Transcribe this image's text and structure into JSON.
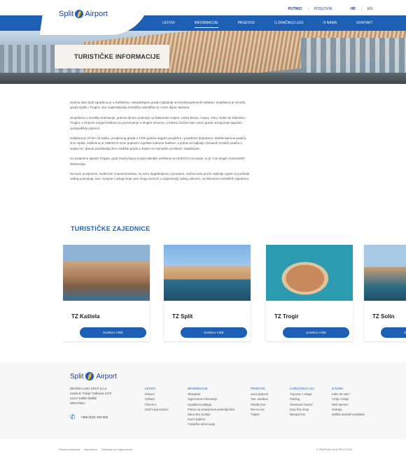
{
  "utility": {
    "putnici": "PUTNICI",
    "poslovni": "POSLOVNI",
    "hr": "HR",
    "en": "EN"
  },
  "brand": {
    "name": "Split",
    "suffix": "Airport"
  },
  "nav": {
    "items": [
      {
        "label": "LETOVI"
      },
      {
        "label": "INFORMACIJE",
        "active": true
      },
      {
        "label": "PRIJEVOZ"
      },
      {
        "label": "U ZRAČNOJ LUCI"
      },
      {
        "label": "O NAMA"
      },
      {
        "label": "KONTAKT"
      }
    ]
  },
  "page": {
    "title": "TURISTIČKE INFORMACIJE"
  },
  "intro": [
    "Zračna luka Split zgrađena je u Kaštelima, nekadašnjem gradu najstarije od srednjovjekovnih kaštela i smještena je između grada Splita i Trogira, dva najatraktivnija turistička odredišta na ovom dijelu Jadrana.",
    "Smještena u središtu Dalmacije, pokriva široko područje od Makarske rivijere, otoka Brača, Hvara, Visa i Šolte do Šibenika i Trogira, s brojnim mogućnostima za povezivanje s drugim otocima, a blizina zračne luke ovom gradu omogućuje lagodan cjelogodišnji prijevoz.",
    "Udaljena je 20 km od Splita, povijesnog grada s 1700 godina dugom poviješću i posebnim ljepotama. Dioklecijanova palača, srce Splita, zaštićena je UNESCO-ovim popisom svjetske kulturne baštine, a jedna od najbolje očuvanih rimskih palača u svijetu te i danas predstavlja živo središte grada u kojem se isprepliću prošlost i sadašnjost.",
    "Uz povijesne ljepote Trogira, grad muzej čija je jezgra također uvrštena na UNESCO-ov popis, tu je i niz drugih izvanrednih destinacija.",
    "Sa svim povijesnim i kulturnim znamenitostima, sa svim događanjima i ponudom, zračna luka pruža najbolje uvjete za početak vašeg putovanja, kao i savjete i usluge koje vam mogu pomoći u organizaciji vašeg odmora, na linkovima turističkih zajednica."
  ],
  "communities": {
    "title": "TURISTIČKE ZAJEDNICE",
    "button_label": "SAZNAJ VIŠE",
    "items": [
      {
        "name": "TZ Kaštela"
      },
      {
        "name": "TZ Split"
      },
      {
        "name": "TZ Trogir"
      },
      {
        "name": "TZ Solin"
      }
    ]
  },
  "footer": {
    "address": [
      "ZRAČNA LUKA SPLIT d.o.o.",
      "Cesta dr. Franje Tuđmana 1270",
      "21217 Kaštel Štafilić",
      "HRVATSKA"
    ],
    "phone": "+385 (0)21 203 506",
    "columns": [
      {
        "heading": "LETOVI",
        "links": [
          "Dolasci",
          "Odlasci",
          "Check-in",
          "Zračni prijevoznici"
        ]
      },
      {
        "heading": "INFORMACIJE",
        "links": [
          "Obavijesti",
          "Sigurnosne informacije",
          "Izgubljena prtljaga",
          "Putnici sa smanjenom pokretljivošću",
          "Djeca bez pratnje",
          "Kućni ljubimci",
          "Turističke informacije"
        ]
      },
      {
        "heading": "PRIJEVOZ",
        "links": [
          "Javni prijevoz",
          "Taxi, autobus",
          "Shuttle bus",
          "Rent-a-car",
          "Trajekt"
        ]
      },
      {
        "heading": "U ZRAČNOJ LUCI",
        "links": [
          "Trgovine i usluge",
          "Parking",
          "Restorani i barovi",
          "Duty free shop",
          "Mjenjačnice"
        ]
      },
      {
        "heading": "O NAMA",
        "links": [
          "Kako do nas?",
          "Vizija i misija",
          "Web kamere",
          "Galerija",
          "Zaštita osobnih podataka"
        ]
      }
    ]
  },
  "bottom": {
    "links": [
      "Pravila privatnosti",
      "Impressum",
      "Odricanje od odgovornosti"
    ],
    "copyright": "© ZRAČNA LUKA SPLIT 2019"
  }
}
